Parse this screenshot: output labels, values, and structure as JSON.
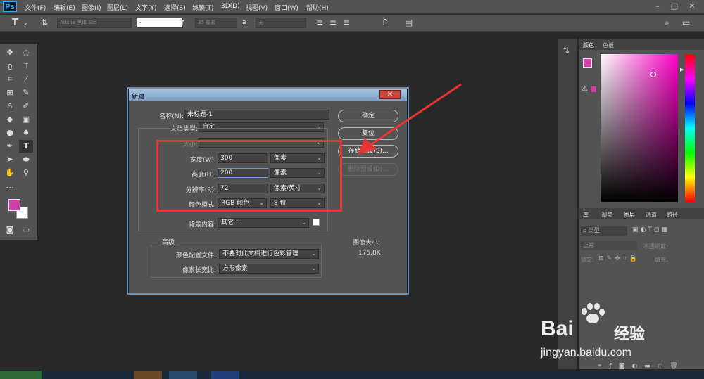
{
  "menubar": {
    "logo": "Ps",
    "items": [
      "文件(F)",
      "编辑(E)",
      "图像(I)",
      "图层(L)",
      "文字(Y)",
      "选择(S)",
      "滤镜(T)",
      "3D(D)",
      "视图(V)",
      "窗口(W)",
      "帮助(H)"
    ],
    "win_buttons": [
      "–",
      "□",
      "✕"
    ]
  },
  "options": {
    "font_family": "Adobe 黑体 Std",
    "font_style": "-",
    "font_size": "35 像素",
    "aa_label": "a",
    "aa_mode": "无",
    "text_color": "#d13fa8"
  },
  "dialog": {
    "title": "新建",
    "close_symbol": "✕",
    "name_label": "名称(N):",
    "name_value": "未标题-1",
    "doctype_label": "文档类型:",
    "doctype_value": "自定",
    "size_label": "大小:",
    "width_label": "宽度(W):",
    "width_value": "300",
    "width_unit": "像素",
    "height_label": "高度(H):",
    "height_value": "200",
    "height_unit": "像素",
    "res_label": "分辨率(R):",
    "res_value": "72",
    "res_unit": "像素/英寸",
    "colormode_label": "颜色模式:",
    "colormode_value": "RGB 颜色",
    "bitdepth_value": "8 位",
    "bg_label": "背景内容:",
    "bg_value": "其它...",
    "advanced_label": "高级",
    "profile_label": "颜色配置文件:",
    "profile_value": "不要对此文档进行色彩管理",
    "aspect_label": "像素长宽比:",
    "aspect_value": "方形像素",
    "ok_label": "确定",
    "reset_label": "复位",
    "save_preset_label": "存储预设(S)...",
    "delete_preset_label": "删除预设(D)...",
    "image_size_label": "图像大小:",
    "image_size_value": "175.8K"
  },
  "panels": {
    "color_tabs": [
      "颜色",
      "色板"
    ],
    "layer_tabs": [
      "库",
      "调整",
      "图层",
      "通道",
      "路径"
    ],
    "kind_label": "ρ 类型",
    "blend_mode": "正常",
    "opacity_label": "不透明度:",
    "lock_label": "锁定:",
    "fill_label": "填充:",
    "fg_color": "#d13fa8"
  },
  "watermark": {
    "brand": "Bai",
    "brand_suffix": "经验",
    "url": "jingyan.baidu.com"
  }
}
